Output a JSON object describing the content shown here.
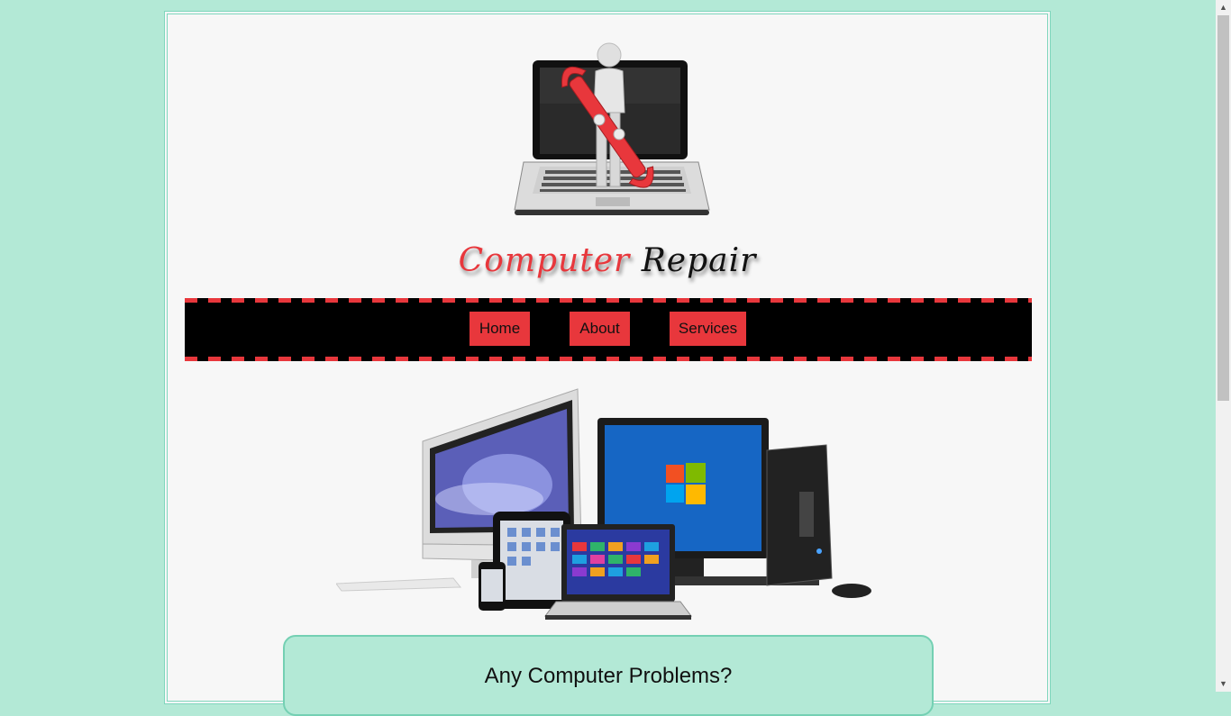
{
  "header": {
    "title_word1": "Computer",
    "title_word2": "Repair",
    "logo_icon": "laptop-repair-figure-icon"
  },
  "nav": {
    "items": [
      {
        "label": "Home"
      },
      {
        "label": "About"
      },
      {
        "label": "Services"
      }
    ]
  },
  "hero": {
    "image_icon": "devices-group-icon"
  },
  "problems": {
    "heading": "Any Computer Problems?"
  },
  "colors": {
    "background": "#b3e9d6",
    "page": "#f7f7f7",
    "accent": "#e8373c",
    "nav_bg": "#000000",
    "border": "#7fd6bd"
  },
  "scrollbar": {
    "up_icon": "scroll-up-icon",
    "down_icon": "scroll-down-icon"
  }
}
